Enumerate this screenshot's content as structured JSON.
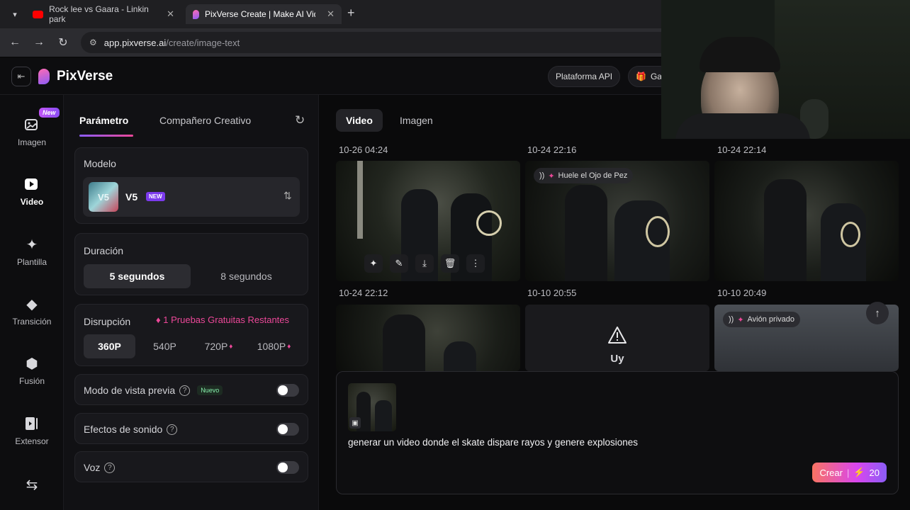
{
  "browser": {
    "tabs": [
      {
        "title": "Rock lee vs Gaara - Linkin park",
        "icon": "youtube-icon"
      },
      {
        "title": "PixVerse Create | Make AI Video",
        "icon": "pixverse-icon"
      }
    ],
    "url_host": "app.pixverse.ai",
    "url_path": "/create/image-text"
  },
  "app": {
    "brand": "PixVerse",
    "api_button": "Plataforma API",
    "gift_button": "Ga"
  },
  "nav": {
    "new_badge": "New",
    "items": [
      {
        "label": "Imagen",
        "icon": "image-sparkle-icon"
      },
      {
        "label": "Video",
        "icon": "video-icon"
      },
      {
        "label": "Plantilla",
        "icon": "sparkle-icon"
      },
      {
        "label": "Transición",
        "icon": "transition-icon"
      },
      {
        "label": "Fusión",
        "icon": "cube-icon"
      },
      {
        "label": "Extensor",
        "icon": "extend-icon"
      }
    ]
  },
  "params": {
    "tab_params": "Parámetro",
    "tab_companion": "Compañero Creativo",
    "model_label": "Modelo",
    "model_name": "V5",
    "model_badge": "NEW",
    "model_thumb_text": "V5",
    "duration_label": "Duración",
    "duration_options": [
      "5 segundos",
      "8 segundos"
    ],
    "resolution_label": "Disrupción",
    "free_trials": "1 Pruebas Gratuitas Restantes",
    "resolution_options": [
      "360P",
      "540P",
      "720P",
      "1080P"
    ],
    "preview_label": "Modo de vista previa",
    "preview_badge": "Nuevo",
    "sound_label": "Efectos de sonido",
    "voice_label": "Voz"
  },
  "main": {
    "tab_video": "Video",
    "tab_image": "Imagen",
    "timestamps": [
      "10-26 04:24",
      "10-24 22:16",
      "10-24 22:14",
      "10-24 22:12",
      "10-10 20:55",
      "10-10 20:49"
    ],
    "labels": [
      "Huele el Ojo de Pez",
      "Avión privado"
    ],
    "error_text": "Uy",
    "prompt_text": "generar un video donde el skate dispare rayos y genere explosiones",
    "create_label": "Crear",
    "create_cost": "20"
  },
  "colors": {
    "accent_pink": "#ec4899",
    "accent_purple": "#8b5cf6",
    "background": "#0a0a0b"
  }
}
